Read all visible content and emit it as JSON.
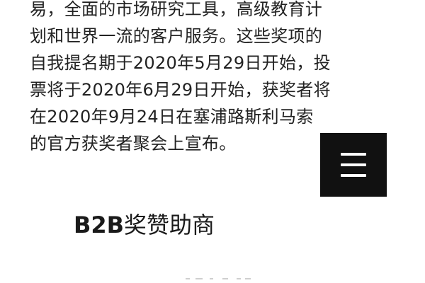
{
  "article": {
    "lines": [
      "易，全面的市场研究工具，高级教育计",
      "划和世界一流的客户服务。这些奖项的",
      "自我提名期于2020年5月29日开始，投",
      "票将于2020年6月29日开始，获奖者将",
      "在2020年9月24日在塞浦路斯利马索",
      "的官方获奖者聚会上宣布。"
    ]
  },
  "section": {
    "heading_latin": "B2B",
    "heading_rest": "奖赞助商"
  },
  "menu": {
    "icon": "hamburger-menu-icon",
    "button_color": "#111111",
    "icon_color": "#ffffff"
  }
}
